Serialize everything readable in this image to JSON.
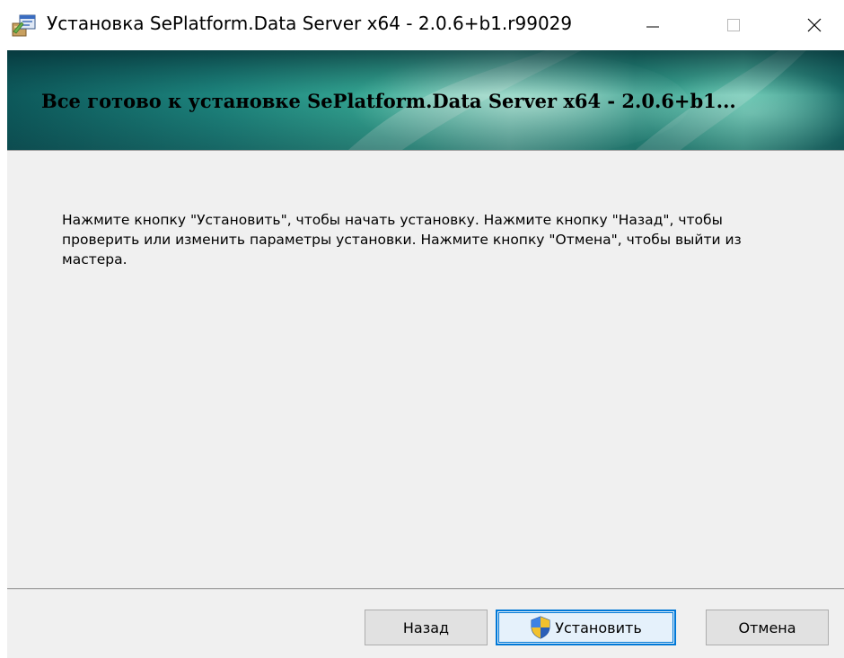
{
  "window": {
    "title": "Установка SePlatform.Data Server  x64 - 2.0.6+b1.r99029",
    "icon": "installer-package-icon",
    "controls": [
      "minimize-icon",
      "maximize-icon",
      "close-icon"
    ]
  },
  "banner": {
    "title": "Все готово к установке SePlatform.Data Server  x64 - 2.0.6+b1..."
  },
  "main": {
    "message": "Нажмите кнопку \"Установить\", чтобы начать установку. Нажмите кнопку \"Назад\", чтобы проверить или изменить параметры установки. Нажмите кнопку \"Отмена\", чтобы выйти из мастера."
  },
  "footer": {
    "back_label": "Назад",
    "install_label": "Установить",
    "install_icon": "uac-shield-icon",
    "cancel_label": "Отмена"
  },
  "colors": {
    "content_bg": "#f0f0f0",
    "focus_border": "#0078d7",
    "button_bg": "#e1e1e1"
  }
}
